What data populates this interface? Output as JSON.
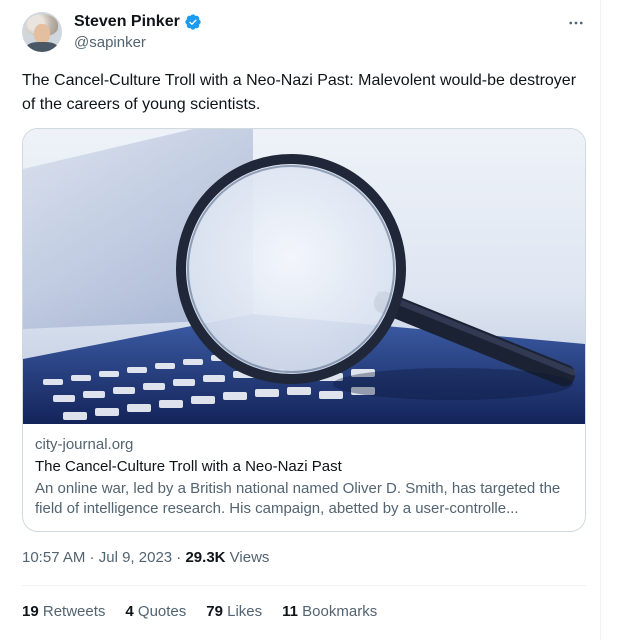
{
  "author": {
    "display_name": "Steven Pinker",
    "handle": "@sapinker",
    "verified_icon": "verified-badge-icon",
    "accent_color": "#1d9bf0"
  },
  "header": {
    "more_icon": "more-options-icon"
  },
  "tweet": {
    "text": "The Cancel-Culture Troll with a Neo-Nazi Past: Malevolent would-be destroyer of the careers of young scientists."
  },
  "card": {
    "image_icon": "magnifying-glass-over-laptop-image",
    "domain": "city-journal.org",
    "title": "The Cancel-Culture Troll with a Neo-Nazi Past",
    "description": "An online war, led by a British national named Oliver D. Smith, has targeted the field of intelligence research. His campaign, abetted by a user-controlle..."
  },
  "meta": {
    "time": "10:57 AM",
    "separator1": " · ",
    "date": "Jul 9, 2023",
    "separator2": " · ",
    "views_count": "29.3K",
    "views_label": " Views"
  },
  "stats": {
    "retweets_count": "19",
    "retweets_label": " Retweets",
    "quotes_count": "4",
    "quotes_label": " Quotes",
    "likes_count": "79",
    "likes_label": " Likes",
    "bookmarks_count": "11",
    "bookmarks_label": " Bookmarks"
  }
}
